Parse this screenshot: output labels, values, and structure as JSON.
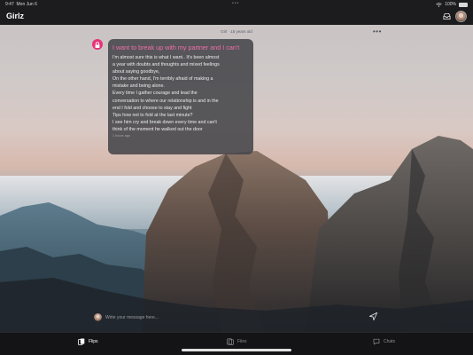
{
  "status_bar": {
    "time": "9:47",
    "date": "Mon Jun 6",
    "battery": "100%",
    "multitask_dots": "•••"
  },
  "navbar": {
    "app_title": "Girlz"
  },
  "post": {
    "meta": "Girl · 15 years old",
    "more": "•••",
    "title": "I want to break up with my partner and I can't",
    "body_lines": [
      "I'm almost sure this is what I want.. It's been almost",
      "a year with doubts and thoughts and mixed feelings",
      "about saying goodbye,",
      "On the other hand, I'm terribly afraid of making a",
      "mistake and being alone.",
      "Every time I gather courage and lead the",
      "conversation to where our relationship is and in the",
      "end I fold and choose to stay and fight",
      "Tips how not to fold at the last minute?",
      "I see him cry and break down every time and can't",
      "think of the moment he walked out the door"
    ],
    "time_ago": "1 hours ago"
  },
  "composer": {
    "placeholder": "Write your message here..."
  },
  "tabs": [
    {
      "label": "Flips",
      "icon": "flips-icon",
      "active": true
    },
    {
      "label": "Files",
      "icon": "files-icon",
      "active": false
    },
    {
      "label": "Chats",
      "icon": "chat-icon",
      "active": false
    }
  ],
  "colors": {
    "accent_pink": "#e6337a",
    "title_pink": "#f070ab",
    "bar_bg": "#1c1c1e"
  }
}
